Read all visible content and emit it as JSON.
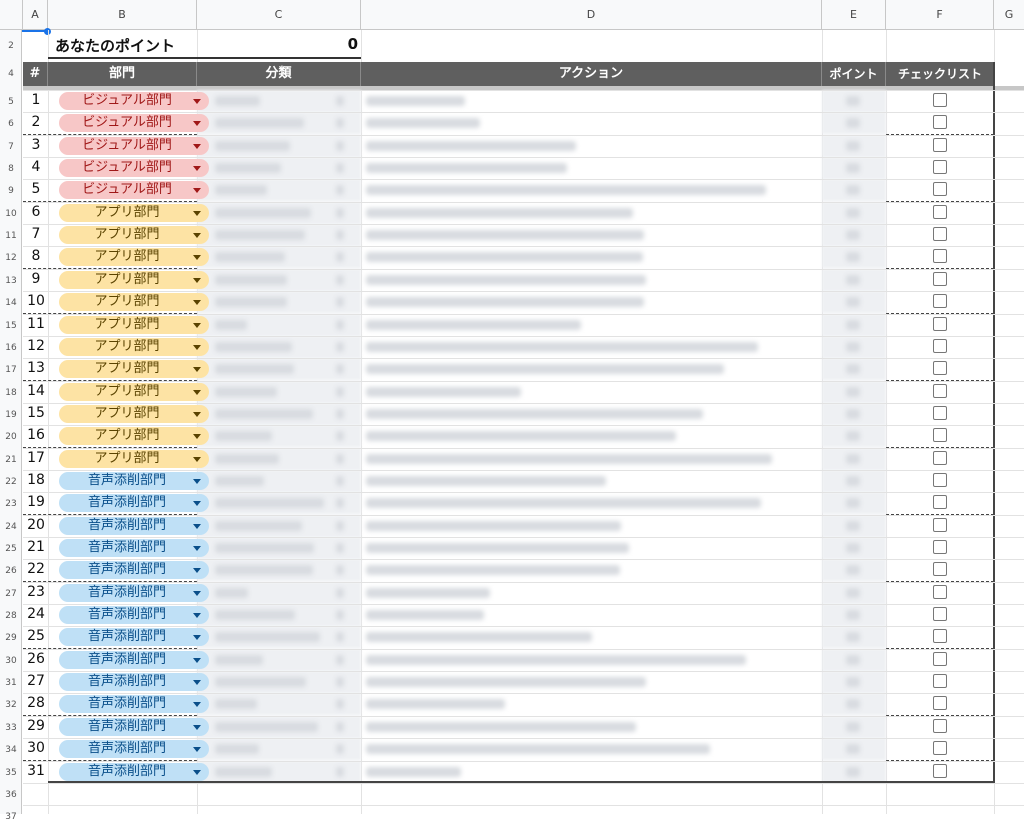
{
  "columns": [
    "A",
    "B",
    "C",
    "D",
    "E",
    "F",
    "G"
  ],
  "row_numbers": [
    "2",
    "4",
    "5",
    "6",
    "7",
    "8",
    "9",
    "10",
    "11",
    "12",
    "13",
    "14",
    "15",
    "16",
    "17",
    "18",
    "19",
    "20",
    "21",
    "22",
    "23",
    "24",
    "25",
    "26",
    "27",
    "28",
    "29",
    "30",
    "31",
    "32",
    "33",
    "34",
    "35",
    "36",
    "37"
  ],
  "points": {
    "label": "あなたのポイント",
    "value": "0"
  },
  "table_headers": {
    "num": "#",
    "department": "部門",
    "category": "分類",
    "action": "アクション",
    "points": "ポイント",
    "checklist": "チェックリスト"
  },
  "rows": [
    {
      "n": "1",
      "dept": "ビジュアル部門",
      "color": "red"
    },
    {
      "n": "2",
      "dept": "ビジュアル部門",
      "color": "red"
    },
    {
      "n": "3",
      "dept": "ビジュアル部門",
      "color": "red"
    },
    {
      "n": "4",
      "dept": "ビジュアル部門",
      "color": "red"
    },
    {
      "n": "5",
      "dept": "ビジュアル部門",
      "color": "red"
    },
    {
      "n": "6",
      "dept": "アプリ部門",
      "color": "yellow"
    },
    {
      "n": "7",
      "dept": "アプリ部門",
      "color": "yellow"
    },
    {
      "n": "8",
      "dept": "アプリ部門",
      "color": "yellow"
    },
    {
      "n": "9",
      "dept": "アプリ部門",
      "color": "yellow"
    },
    {
      "n": "10",
      "dept": "アプリ部門",
      "color": "yellow"
    },
    {
      "n": "11",
      "dept": "アプリ部門",
      "color": "yellow"
    },
    {
      "n": "12",
      "dept": "アプリ部門",
      "color": "yellow"
    },
    {
      "n": "13",
      "dept": "アプリ部門",
      "color": "yellow"
    },
    {
      "n": "14",
      "dept": "アプリ部門",
      "color": "yellow"
    },
    {
      "n": "15",
      "dept": "アプリ部門",
      "color": "yellow"
    },
    {
      "n": "16",
      "dept": "アプリ部門",
      "color": "yellow"
    },
    {
      "n": "17",
      "dept": "アプリ部門",
      "color": "yellow"
    },
    {
      "n": "18",
      "dept": "音声添削部門",
      "color": "blue"
    },
    {
      "n": "19",
      "dept": "音声添削部門",
      "color": "blue"
    },
    {
      "n": "20",
      "dept": "音声添削部門",
      "color": "blue"
    },
    {
      "n": "21",
      "dept": "音声添削部門",
      "color": "blue"
    },
    {
      "n": "22",
      "dept": "音声添削部門",
      "color": "blue"
    },
    {
      "n": "23",
      "dept": "音声添削部門",
      "color": "blue"
    },
    {
      "n": "24",
      "dept": "音声添削部門",
      "color": "blue"
    },
    {
      "n": "25",
      "dept": "音声添削部門",
      "color": "blue"
    },
    {
      "n": "26",
      "dept": "音声添削部門",
      "color": "blue"
    },
    {
      "n": "27",
      "dept": "音声添削部門",
      "color": "blue"
    },
    {
      "n": "28",
      "dept": "音声添削部門",
      "color": "blue"
    },
    {
      "n": "29",
      "dept": "音声添削部門",
      "color": "blue"
    },
    {
      "n": "30",
      "dept": "音声添削部門",
      "color": "blue"
    },
    {
      "n": "31",
      "dept": "音声添削部門",
      "color": "blue"
    }
  ],
  "colors": {
    "header_bg": "#5f5f5f",
    "red_chip": "#f7c7c7",
    "yellow_chip": "#fde3a4",
    "blue_chip": "#bfe0f6"
  }
}
